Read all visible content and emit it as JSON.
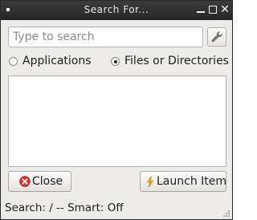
{
  "window": {
    "title": "Search For..."
  },
  "search": {
    "placeholder": "Type to search",
    "value": ""
  },
  "icons": {
    "window_menu": "window-menu-icon",
    "preferences": "wrench-icon",
    "close": "close-circle-icon",
    "launch": "lightning-icon"
  },
  "scope": {
    "options": [
      {
        "label": "Applications",
        "checked": false
      },
      {
        "label": "Files or Directories",
        "checked": true
      }
    ]
  },
  "results": [],
  "buttons": {
    "close_label": "Close",
    "launch_label": "Launch Item"
  },
  "status": {
    "text": "Search: / -- Smart: Off"
  },
  "colors": {
    "titlebar": "#2f2f2f",
    "window_bg": "#edebe8",
    "close_icon": "#d9322b",
    "launch_icon": "#f0b400"
  }
}
